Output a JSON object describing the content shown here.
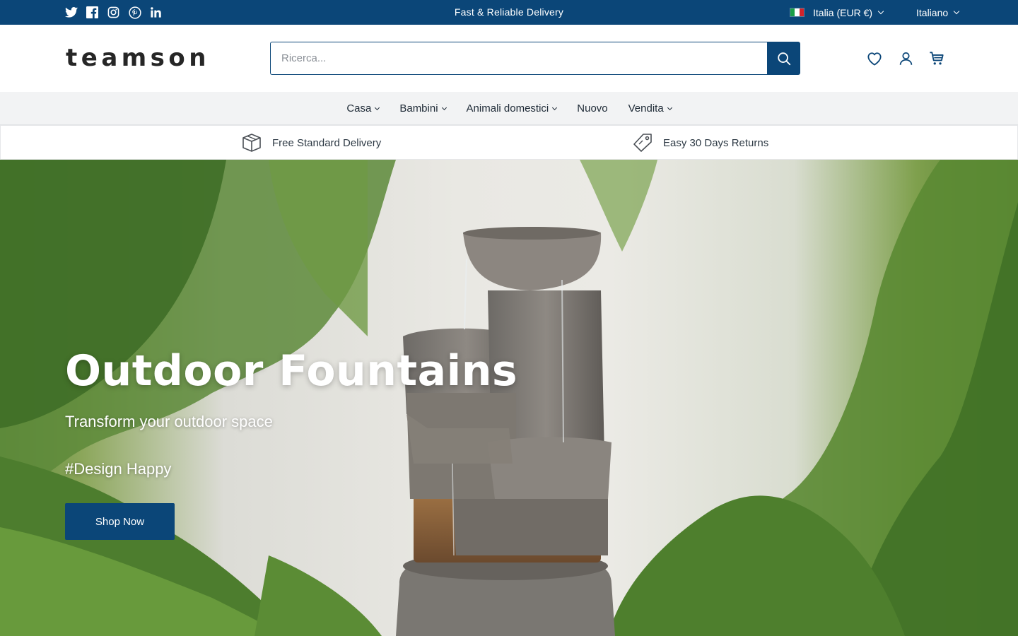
{
  "topbar": {
    "announcement": "Fast & Reliable Delivery",
    "country": "Italia (EUR €)",
    "language": "Italiano",
    "social": [
      "twitter-icon",
      "facebook-icon",
      "instagram-icon",
      "pinterest-icon",
      "linkedin-icon"
    ]
  },
  "header": {
    "logo": "teamson",
    "search_placeholder": "Ricerca...",
    "icons": [
      "wishlist-icon",
      "account-icon",
      "cart-icon"
    ]
  },
  "nav": {
    "items": [
      {
        "label": "Casa",
        "dropdown": true
      },
      {
        "label": "Bambini",
        "dropdown": true
      },
      {
        "label": "Animali domestici",
        "dropdown": true
      },
      {
        "label": "Nuovo",
        "dropdown": false
      },
      {
        "label": "Vendita",
        "dropdown": true
      }
    ]
  },
  "benefits": [
    {
      "label": "Free Standard Delivery",
      "icon": "box-icon"
    },
    {
      "label": "Easy 30 Days Returns",
      "icon": "tag-icon"
    }
  ],
  "hero": {
    "title": "Outdoor Fountains",
    "subtitle": "Transform your outdoor space",
    "tag": "#Design Happy",
    "cta": "Shop Now"
  },
  "colors": {
    "brand": "#0b4678",
    "nav_bg": "#f2f3f4",
    "text": "#1e2a36"
  }
}
